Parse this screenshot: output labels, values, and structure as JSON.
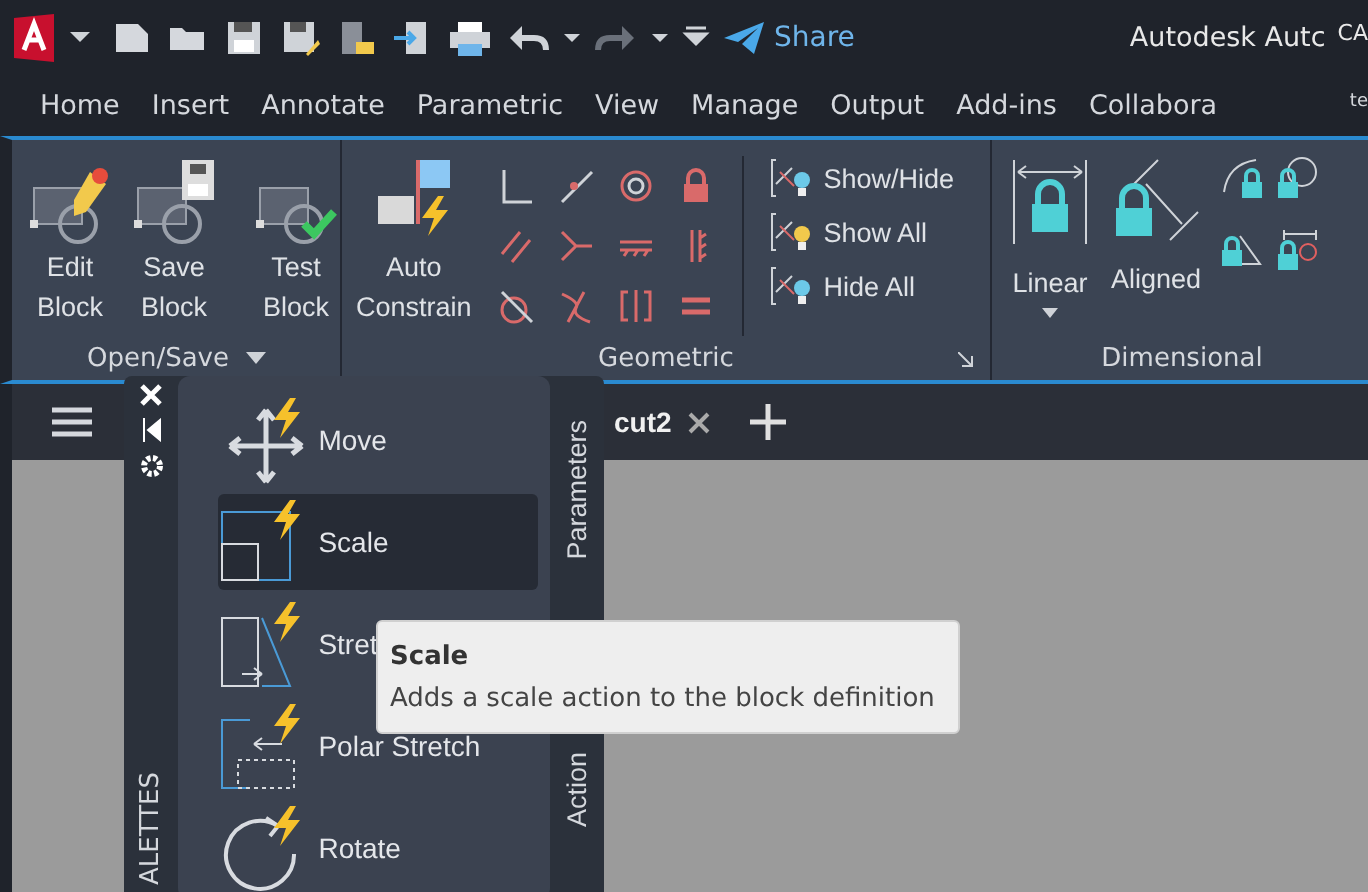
{
  "title_bar": {
    "share": "Share",
    "app_title": "Autodesk Autc",
    "cut_text": "CA"
  },
  "menu_tabs": [
    "Home",
    "Insert",
    "Annotate",
    "Parametric",
    "View",
    "Manage",
    "Output",
    "Add-ins",
    "Collabora"
  ],
  "menu_edge_text": "te",
  "ribbon": {
    "open_save": {
      "title": "Open/Save",
      "buttons": [
        {
          "kind": "edit",
          "label": "Edit Block"
        },
        {
          "kind": "save",
          "label": "Save Block"
        },
        {
          "kind": "test",
          "label": "Test Block"
        }
      ]
    },
    "geometric": {
      "title": "Geometric",
      "auto": "Auto Constrain",
      "constraints": [
        {
          "kind": "perpendicular"
        },
        {
          "kind": "coincident"
        },
        {
          "kind": "concentric"
        },
        {
          "kind": "fix"
        },
        {
          "kind": "parallel"
        },
        {
          "kind": "collinear"
        },
        {
          "kind": "horizontal"
        },
        {
          "kind": "vertical"
        },
        {
          "kind": "tangent"
        },
        {
          "kind": "smooth"
        },
        {
          "kind": "symmetric"
        },
        {
          "kind": "equal"
        }
      ],
      "display": [
        "Show/Hide",
        "Show All",
        "Hide All"
      ]
    },
    "dimensional": {
      "title": "Dimensional",
      "buttons": [
        {
          "kind": "linear",
          "label": "Linear"
        },
        {
          "kind": "aligned",
          "label": "Aligned"
        }
      ],
      "small": [
        {
          "kind": "angular"
        },
        {
          "kind": "radial"
        },
        {
          "kind": "angular-fixed"
        },
        {
          "kind": "convert"
        }
      ]
    }
  },
  "document_tab": {
    "label": "cut2"
  },
  "palette": {
    "title": "ALETTES",
    "side_tabs": [
      "Parameters",
      "Action"
    ],
    "items": [
      {
        "kind": "move",
        "label": "Move",
        "selected": false
      },
      {
        "kind": "scale",
        "label": "Scale",
        "selected": true
      },
      {
        "kind": "stretch",
        "label": "Stret",
        "selected": false
      },
      {
        "kind": "polar",
        "label": "Polar Stretch",
        "selected": false
      },
      {
        "kind": "rotate",
        "label": "Rotate",
        "selected": false
      }
    ]
  },
  "tooltip": {
    "title": "Scale",
    "description": "Adds a scale action to the block definition"
  }
}
